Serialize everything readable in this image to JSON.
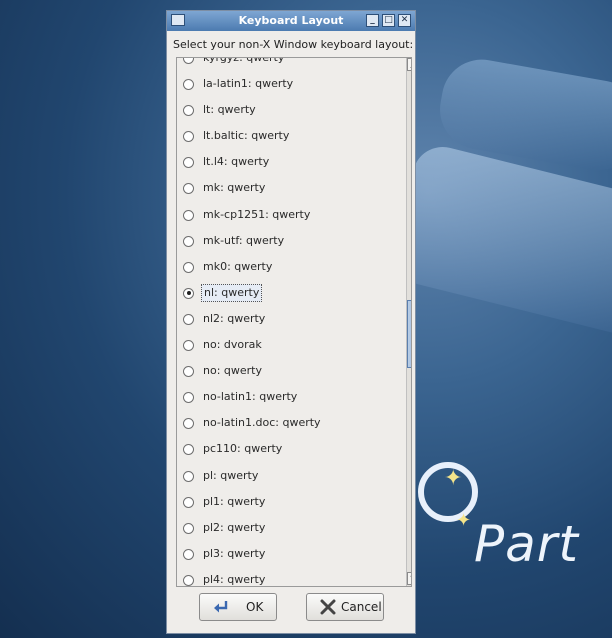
{
  "window": {
    "title": "Keyboard Layout",
    "prompt": "Select your non-X Window keyboard layout:"
  },
  "layouts": [
    {
      "label": "kyrgyz: qwerty",
      "selected": false
    },
    {
      "label": "la-latin1: qwerty",
      "selected": false
    },
    {
      "label": "lt: qwerty",
      "selected": false
    },
    {
      "label": "lt.baltic: qwerty",
      "selected": false
    },
    {
      "label": "lt.l4: qwerty",
      "selected": false
    },
    {
      "label": "mk: qwerty",
      "selected": false
    },
    {
      "label": "mk-cp1251: qwerty",
      "selected": false
    },
    {
      "label": "mk-utf: qwerty",
      "selected": false
    },
    {
      "label": "mk0: qwerty",
      "selected": false
    },
    {
      "label": "nl: qwerty",
      "selected": true
    },
    {
      "label": "nl2: qwerty",
      "selected": false
    },
    {
      "label": "no: dvorak",
      "selected": false
    },
    {
      "label": "no: qwerty",
      "selected": false
    },
    {
      "label": "no-latin1: qwerty",
      "selected": false
    },
    {
      "label": "no-latin1.doc: qwerty",
      "selected": false
    },
    {
      "label": "pc110: qwerty",
      "selected": false
    },
    {
      "label": "pl: qwerty",
      "selected": false
    },
    {
      "label": "pl1: qwerty",
      "selected": false
    },
    {
      "label": "pl2: qwerty",
      "selected": false
    },
    {
      "label": "pl3: qwerty",
      "selected": false
    },
    {
      "label": "pl4: qwerty",
      "selected": false
    }
  ],
  "buttons": {
    "ok": "OK",
    "cancel": "Cancel"
  },
  "desktop": {
    "logo_text": "Part"
  },
  "colors": {
    "titlebar": "#4c7bb0",
    "window_bg": "#efedea",
    "scroll_thumb": "#8fb0d8"
  }
}
